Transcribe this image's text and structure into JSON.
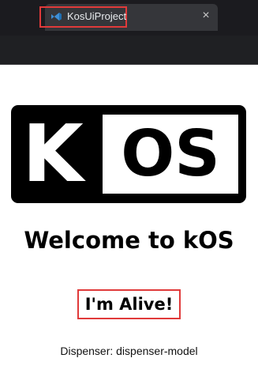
{
  "browser": {
    "tab_title": "KosUiProject",
    "tab_close_glyph": "×",
    "favicon_icon": "vscode-icon"
  },
  "logo": {
    "letter_k": "K",
    "letters_os": "OS"
  },
  "main": {
    "welcome": "Welcome to kOS",
    "alive": "I'm Alive!",
    "dispenser": "Dispenser: dispenser-model"
  },
  "colors": {
    "tabbar_bg": "#1b1b1f",
    "tab_bg": "#35363a",
    "highlight_border": "#e03a3a",
    "logo_bg": "#000000"
  }
}
